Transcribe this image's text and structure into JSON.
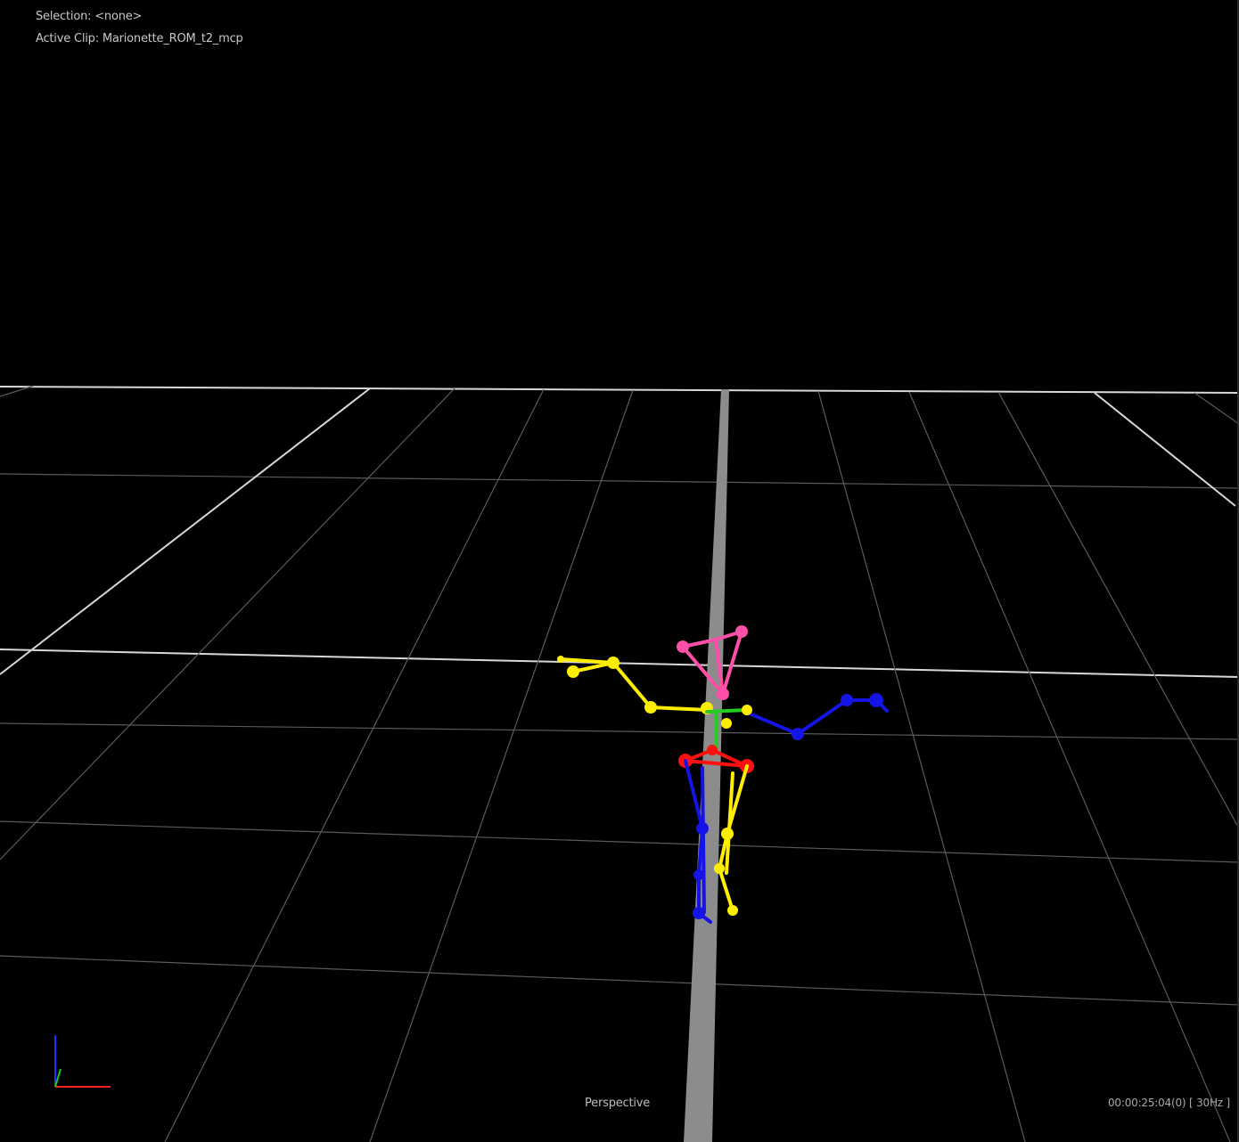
{
  "overlay": {
    "selection_label": "Selection:",
    "selection_value": "<none>",
    "clip_label": "Active Clip:",
    "clip_value": "Marionette_ROM_t2_mcp"
  },
  "viewport": {
    "camera": "Perspective",
    "timecode": "00:00:25:04(0) [ 30Hz ]"
  },
  "colors": {
    "background": "#000000",
    "grid_minor": "#5a5a5a",
    "grid_major": "#d8d8d8",
    "axis_beam": "#8c8c8c",
    "bone_left": "#ffee00",
    "bone_right": "#1414e6",
    "head": "#ff4fa8",
    "hips": "#ff1010",
    "spine": "#22cc22",
    "axis_x": "#ff2020",
    "axis_y": "#20cc20",
    "axis_z": "#2030ff"
  },
  "icons": {
    "axis_gizmo": "axis-triad-icon"
  }
}
